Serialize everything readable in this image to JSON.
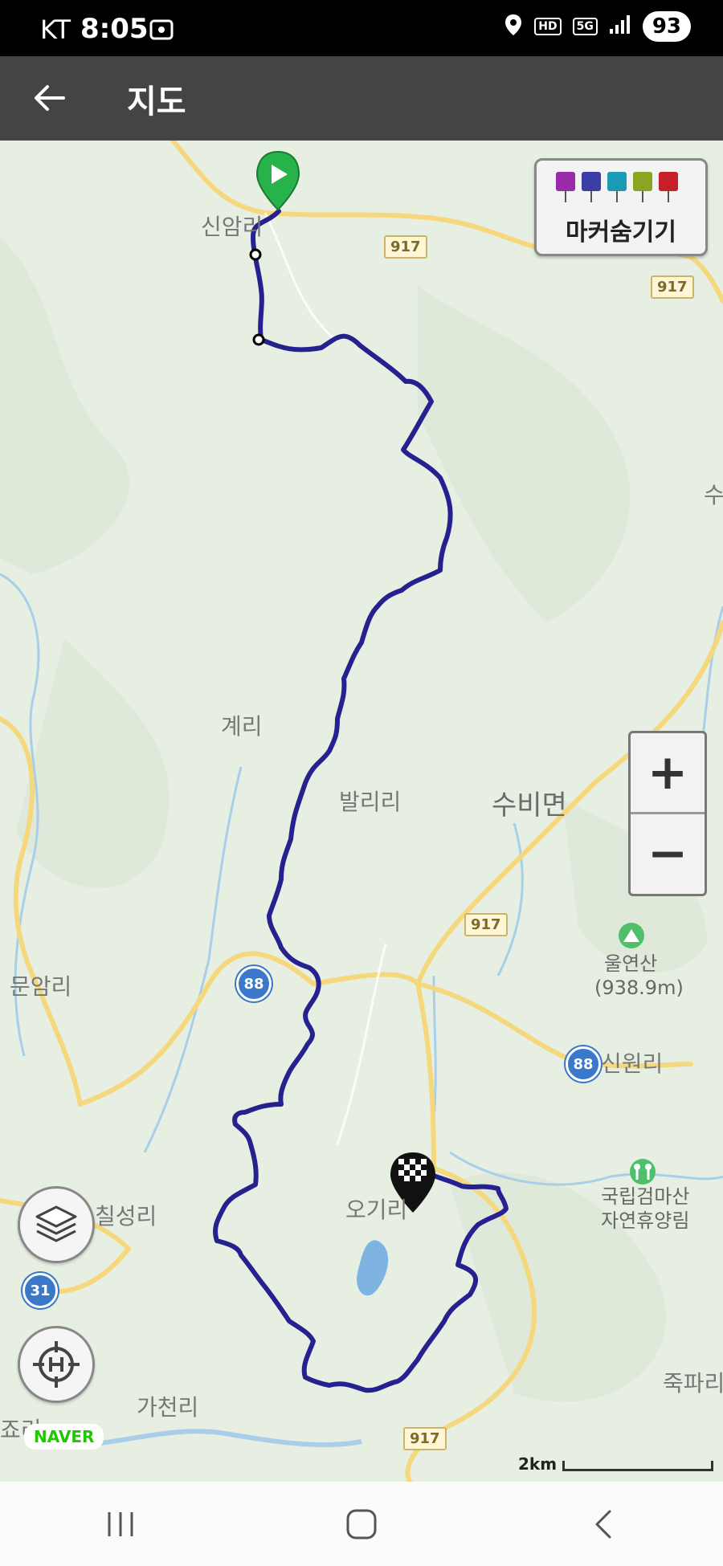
{
  "status_bar": {
    "carrier": "KT",
    "time": "8:05",
    "battery": "93",
    "icons": [
      "screenshot-icon",
      "location-icon",
      "hd-icon",
      "5g-icon",
      "signal-icon"
    ]
  },
  "app_bar": {
    "title": "지도",
    "back_icon": "back-arrow-icon"
  },
  "map": {
    "marker_toggle_label": "마커숨기기",
    "marker_icon_colors": [
      "#9b2aa8",
      "#3a3fa8",
      "#1a9bb3",
      "#8aa520",
      "#c8202a"
    ],
    "route_color": "#25228f",
    "start_marker_color": "#27b24a",
    "places": {
      "sinam": "신암리",
      "gye": "계리",
      "balli": "발리리",
      "subi": "수비면",
      "munam": "문암리",
      "ulyeonsan": "울연산",
      "ulyeonsan_height": "(938.9m)",
      "sinwon": "신원리",
      "ogi": "오기리",
      "chilseong": "칠성리",
      "gumgeom_1": "국립검마산",
      "gumgeom_2": "자연휴양림",
      "gacheon": "가천리",
      "jukpa": "죽파리",
      "edge_su": "수",
      "edge_jo": "죠리"
    },
    "road_badges": {
      "r917_a": "917",
      "r917_b": "917",
      "r917_c": "917",
      "r917_d": "917",
      "r88_a": "88",
      "r88_b": "88",
      "r31": "31"
    },
    "zoom_in": "+",
    "zoom_out": "−",
    "naver_logo": "NAVER",
    "scale_label": "2km"
  },
  "nav_bar": {
    "recent": "recent-apps-icon",
    "home": "home-icon",
    "back": "back-chevron-icon"
  }
}
